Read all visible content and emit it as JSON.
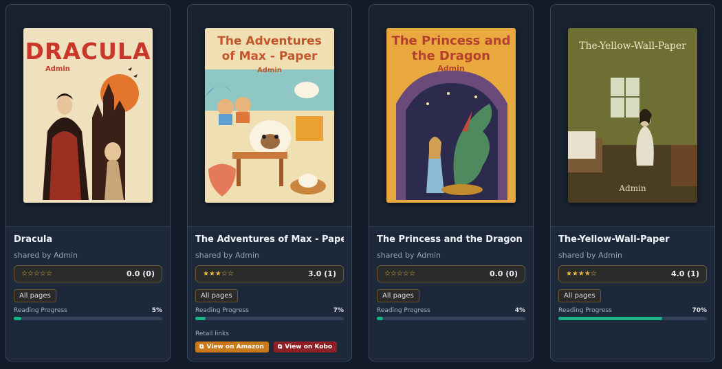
{
  "books": [
    {
      "title": "Dracula",
      "shared_by": "shared by Admin",
      "stars": "☆☆☆☆☆",
      "rating": "0.0 (0)",
      "pages": "All pages",
      "progress_label": "Reading Progress",
      "progress_pct": "5%",
      "progress": 0.05,
      "cover_title": "DRACULA",
      "cover_author": "Admin"
    },
    {
      "title": "The Adventures of Max - Paper",
      "shared_by": "shared by Admin",
      "stars": "★★★☆☆",
      "rating": "3.0 (1)",
      "pages": "All pages",
      "progress_label": "Reading Progress",
      "progress_pct": "7%",
      "progress": 0.07,
      "cover_title": "The Adventures of Max - Paper",
      "cover_author": "Admin",
      "retail_label": "Retail links",
      "amazon_label": "View on Amazon",
      "kobo_label": "View on Kobo"
    },
    {
      "title": "The Princess and the Dragon",
      "shared_by": "shared by Admin",
      "stars": "☆☆☆☆☆",
      "rating": "0.0 (0)",
      "pages": "All pages",
      "progress_label": "Reading Progress",
      "progress_pct": "4%",
      "progress": 0.04,
      "cover_title": "The Princess and the Dragon",
      "cover_author": "Admin"
    },
    {
      "title": "The-Yellow-Wall-Paper",
      "shared_by": "shared by Admin",
      "stars": "★★★★☆",
      "rating": "4.0 (1)",
      "pages": "All pages",
      "progress_label": "Reading Progress",
      "progress_pct": "70%",
      "progress": 0.7,
      "cover_title": "The-Yellow-Wall-Paper",
      "cover_author": "Admin"
    }
  ],
  "colors": {
    "progress_fill": "#17b584",
    "star": "#e8b33a",
    "amazon": "#c9791a",
    "kobo": "#8e1f24"
  }
}
